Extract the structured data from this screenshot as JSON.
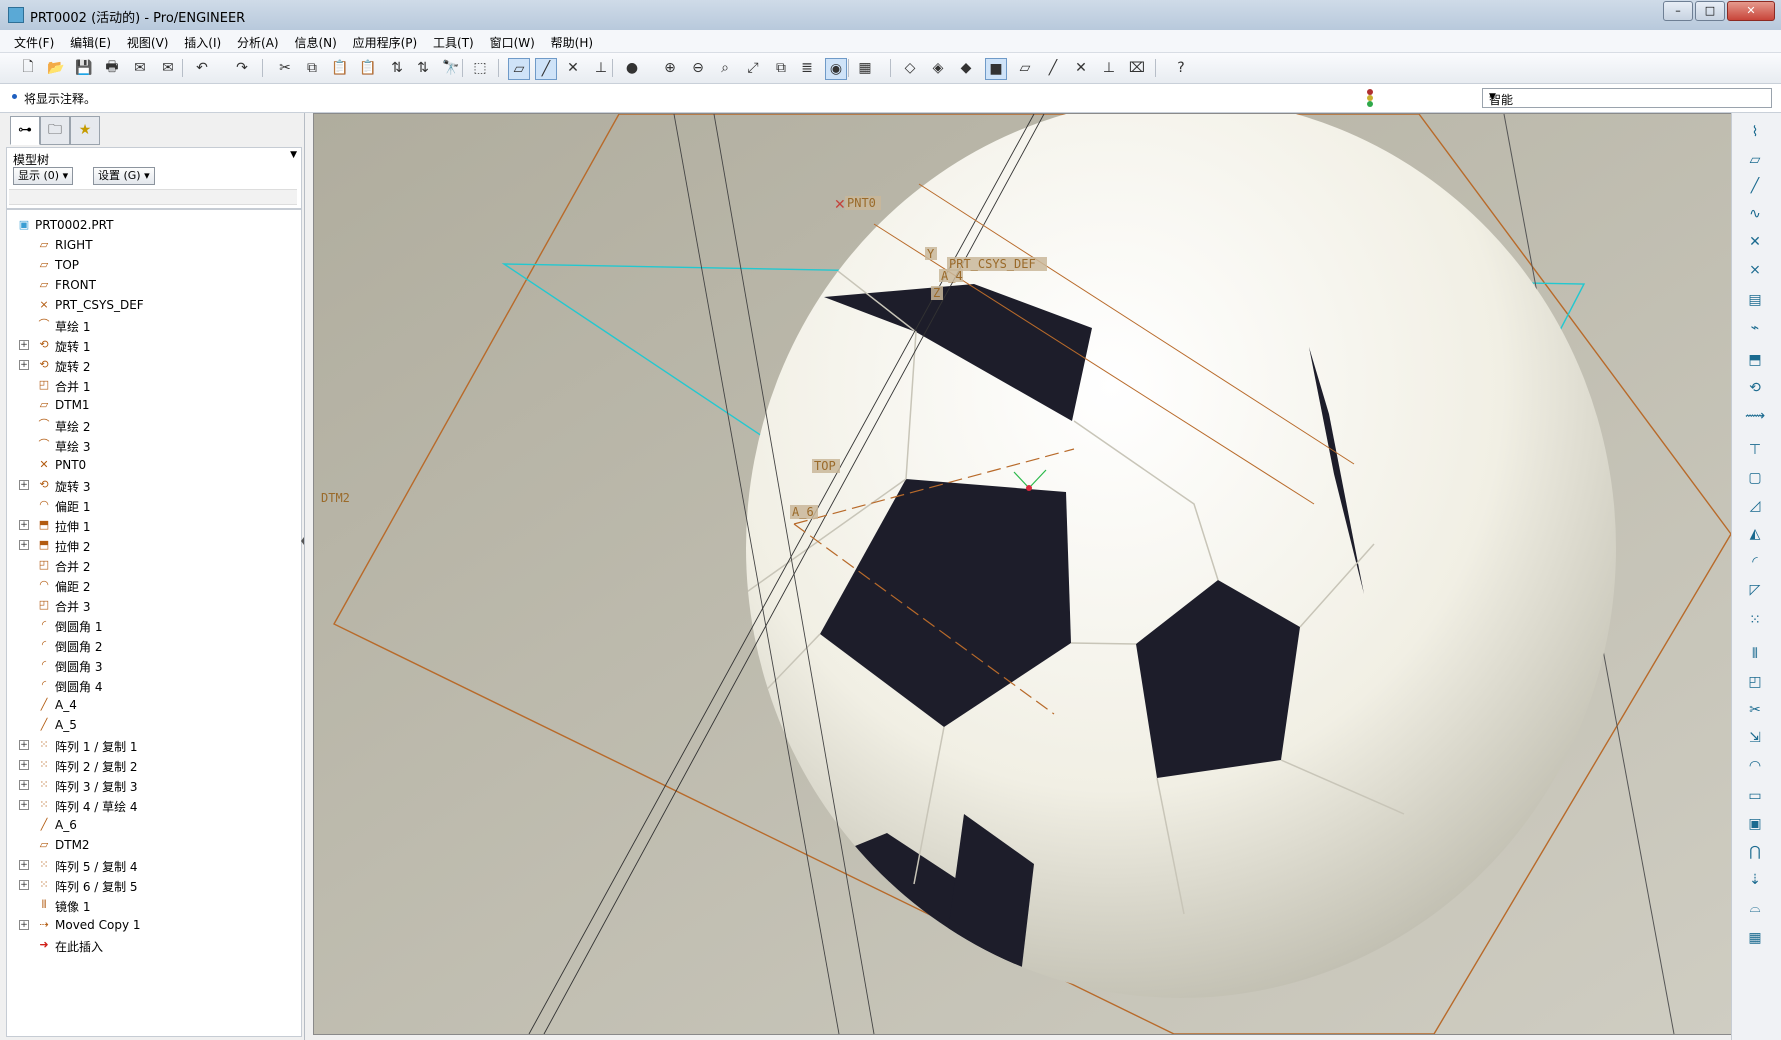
{
  "window": {
    "title": "PRT0002 (活动的) - Pro/ENGINEER",
    "controls": [
      "–",
      "□",
      "✕"
    ]
  },
  "menu": [
    "文件(F)",
    "编辑(E)",
    "视图(V)",
    "插入(I)",
    "分析(A)",
    "信息(N)",
    "应用程序(P)",
    "工具(T)",
    "窗口(W)",
    "帮助(H)"
  ],
  "toolbar": [
    {
      "icon": "new-icon",
      "glyph": "🗋"
    },
    {
      "icon": "open-icon",
      "glyph": "📂"
    },
    {
      "icon": "save-icon",
      "glyph": "💾"
    },
    {
      "icon": "print-icon",
      "glyph": "🖶"
    },
    {
      "icon": "send-mail-icon",
      "glyph": "✉"
    },
    {
      "icon": "send-mail-attach-icon",
      "glyph": "✉"
    },
    {
      "icon": "undo-icon",
      "glyph": "↶"
    },
    {
      "icon": "redo-icon",
      "glyph": "↷"
    },
    {
      "icon": "cut-icon",
      "glyph": "✂"
    },
    {
      "icon": "copy-icon",
      "glyph": "⧉"
    },
    {
      "icon": "paste-icon",
      "glyph": "📋"
    },
    {
      "icon": "paste-special-icon",
      "glyph": "📋"
    },
    {
      "icon": "regenerate-icon",
      "glyph": "⇅"
    },
    {
      "icon": "regenerate-manager-icon",
      "glyph": "⇅"
    },
    {
      "icon": "find-icon",
      "glyph": "🔭"
    },
    {
      "icon": "select-box-icon",
      "glyph": "⬚"
    },
    {
      "icon": "datum-plane-display-icon",
      "glyph": "▱"
    },
    {
      "icon": "datum-axis-display-icon",
      "glyph": "╱"
    },
    {
      "icon": "datum-point-display-icon",
      "glyph": "✕"
    },
    {
      "icon": "csys-display-icon",
      "glyph": "⊥"
    },
    {
      "icon": "shading-icon",
      "glyph": "●"
    },
    {
      "icon": "zoom-in-icon",
      "glyph": "⊕"
    },
    {
      "icon": "zoom-out-icon",
      "glyph": "⊖"
    },
    {
      "icon": "refit-icon",
      "glyph": "⌕"
    },
    {
      "icon": "reorient-icon",
      "glyph": "⤢"
    },
    {
      "icon": "saved-views-icon",
      "glyph": "⧉"
    },
    {
      "icon": "layers-icon",
      "glyph": "≣"
    },
    {
      "icon": "spin-center-icon",
      "glyph": "◉"
    },
    {
      "icon": "appearance-icon",
      "glyph": "▦"
    },
    {
      "icon": "wireframe-icon",
      "glyph": "◇"
    },
    {
      "icon": "hidden-line-icon",
      "glyph": "◈"
    },
    {
      "icon": "no-hidden-icon",
      "glyph": "◆"
    },
    {
      "icon": "shaded-icon",
      "glyph": "■"
    },
    {
      "icon": "plane-tag-icon",
      "glyph": "▱"
    },
    {
      "icon": "axis-tag-icon",
      "glyph": "╱"
    },
    {
      "icon": "point-tag-icon",
      "glyph": "✕"
    },
    {
      "icon": "csys-tag-icon",
      "glyph": "⊥"
    },
    {
      "icon": "annotation-icon",
      "glyph": "⌧"
    },
    {
      "icon": "context-help-icon",
      "glyph": "?"
    }
  ],
  "message": "将显示注释。",
  "filter": {
    "value": "智能"
  },
  "panel": {
    "tabs": [
      {
        "icon": "model-tree-tab-icon",
        "glyph": "⊶"
      },
      {
        "icon": "folder-browser-tab-icon",
        "glyph": "🗀"
      },
      {
        "icon": "favorites-tab-icon",
        "glyph": "★"
      }
    ],
    "header": "模型树",
    "show_btn": "显示 (0)",
    "settings_btn": "设置 (G)"
  },
  "tree": [
    {
      "label": "PRT0002.PRT",
      "icon": "part-icon",
      "glyph": "▣",
      "expand": false,
      "root": true
    },
    {
      "label": "RIGHT",
      "icon": "datum-plane-icon",
      "glyph": "▱",
      "expand": false
    },
    {
      "label": "TOP",
      "icon": "datum-plane-icon",
      "glyph": "▱",
      "expand": false
    },
    {
      "label": "FRONT",
      "icon": "datum-plane-icon",
      "glyph": "▱",
      "expand": false
    },
    {
      "label": "PRT_CSYS_DEF",
      "icon": "csys-icon",
      "glyph": "⨯",
      "expand": false
    },
    {
      "label": "草绘 1",
      "icon": "sketch-icon",
      "glyph": "⌒",
      "expand": false
    },
    {
      "label": "旋转 1",
      "icon": "revolve-icon",
      "glyph": "⟲",
      "expand": true
    },
    {
      "label": "旋转 2",
      "icon": "revolve-icon",
      "glyph": "⟲",
      "expand": true
    },
    {
      "label": "合并 1",
      "icon": "merge-icon",
      "glyph": "◰",
      "expand": false
    },
    {
      "label": "DTM1",
      "icon": "datum-plane-icon",
      "glyph": "▱",
      "expand": false
    },
    {
      "label": "草绘 2",
      "icon": "sketch-icon",
      "glyph": "⌒",
      "expand": false
    },
    {
      "label": "草绘 3",
      "icon": "sketch-icon",
      "glyph": "⌒",
      "expand": false
    },
    {
      "label": "PNT0",
      "icon": "datum-point-icon",
      "glyph": "✕",
      "expand": false
    },
    {
      "label": "旋转 3",
      "icon": "revolve-icon",
      "glyph": "⟲",
      "expand": true
    },
    {
      "label": "偏距 1",
      "icon": "offset-icon",
      "glyph": "◠",
      "expand": false
    },
    {
      "label": "拉伸 1",
      "icon": "extrude-icon",
      "glyph": "⬒",
      "expand": true
    },
    {
      "label": "拉伸 2",
      "icon": "extrude-icon",
      "glyph": "⬒",
      "expand": true
    },
    {
      "label": "合并 2",
      "icon": "merge-icon",
      "glyph": "◰",
      "expand": false
    },
    {
      "label": "偏距 2",
      "icon": "offset-icon",
      "glyph": "◠",
      "expand": false
    },
    {
      "label": "合并 3",
      "icon": "merge-icon",
      "glyph": "◰",
      "expand": false
    },
    {
      "label": "倒圆角 1",
      "icon": "round-icon",
      "glyph": "◜",
      "expand": false
    },
    {
      "label": "倒圆角 2",
      "icon": "round-icon",
      "glyph": "◜",
      "expand": false
    },
    {
      "label": "倒圆角 3",
      "icon": "round-icon",
      "glyph": "◜",
      "expand": false
    },
    {
      "label": "倒圆角 4",
      "icon": "round-icon",
      "glyph": "◜",
      "expand": false
    },
    {
      "label": "A_4",
      "icon": "datum-axis-icon",
      "glyph": "╱",
      "expand": false
    },
    {
      "label": "A_5",
      "icon": "datum-axis-icon",
      "glyph": "╱",
      "expand": false
    },
    {
      "label": "阵列 1 / 复制 1",
      "icon": "pattern-icon",
      "glyph": "⁙",
      "expand": true
    },
    {
      "label": "阵列 2 / 复制 2",
      "icon": "pattern-icon",
      "glyph": "⁙",
      "expand": true
    },
    {
      "label": "阵列 3 / 复制 3",
      "icon": "pattern-icon",
      "glyph": "⁙",
      "expand": true
    },
    {
      "label": "阵列 4 / 草绘 4",
      "icon": "pattern-icon",
      "glyph": "⁙",
      "expand": true
    },
    {
      "label": "A_6",
      "icon": "datum-axis-icon",
      "glyph": "╱",
      "expand": false
    },
    {
      "label": "DTM2",
      "icon": "datum-plane-icon",
      "glyph": "▱",
      "expand": false
    },
    {
      "label": "阵列 5 / 复制 4",
      "icon": "pattern-icon",
      "glyph": "⁙",
      "expand": true
    },
    {
      "label": "阵列 6 / 复制 5",
      "icon": "pattern-icon",
      "glyph": "⁙",
      "expand": true
    },
    {
      "label": "镜像 1",
      "icon": "mirror-icon",
      "glyph": "⫴",
      "expand": false
    },
    {
      "label": "Moved Copy 1",
      "icon": "moved-copy-icon",
      "glyph": "⇢",
      "expand": true
    },
    {
      "label": "在此插入",
      "icon": "insert-here-icon",
      "glyph": "➜",
      "expand": false
    }
  ],
  "viewport": {
    "background": "#a8a69a",
    "labels": {
      "pnt0": "PNT0",
      "csys": "PRT_CSYS_DEF",
      "csys_y": "Y",
      "csys_z": "Z",
      "a4": "A_4",
      "top": "TOP",
      "a6": "A_6",
      "dtm2": "DTM2"
    }
  },
  "rightbar": [
    {
      "icon": "sketch-tool-icon",
      "glyph": "⌇"
    },
    {
      "icon": "plane-tool-icon",
      "glyph": "▱"
    },
    {
      "icon": "axis-tool-icon",
      "glyph": "╱"
    },
    {
      "icon": "curve-tool-icon",
      "glyph": "∿"
    },
    {
      "icon": "point-tool-icon",
      "glyph": "✕"
    },
    {
      "icon": "csys-tool-icon",
      "glyph": "⨯"
    },
    {
      "icon": "analysis-feature-icon",
      "glyph": "▤"
    },
    {
      "icon": "graph-tool-icon",
      "glyph": "⌁"
    },
    {
      "icon": "extrude-tool-icon",
      "glyph": "⬒"
    },
    {
      "icon": "revolve-tool-icon",
      "glyph": "⟲"
    },
    {
      "icon": "variable-section-sweep-icon",
      "glyph": "⟿"
    },
    {
      "icon": "hole-tool-icon",
      "glyph": "⊤"
    },
    {
      "icon": "shell-tool-icon",
      "glyph": "▢"
    },
    {
      "icon": "rib-tool-icon",
      "glyph": "◿"
    },
    {
      "icon": "draft-tool-icon",
      "glyph": "◭"
    },
    {
      "icon": "round-tool-icon",
      "glyph": "◜"
    },
    {
      "icon": "chamfer-tool-icon",
      "glyph": "◸"
    },
    {
      "icon": "pattern-tool-icon",
      "glyph": "⁙"
    },
    {
      "icon": "mirror-tool-icon",
      "glyph": "⫴"
    },
    {
      "icon": "merge-tool-icon",
      "glyph": "◰"
    },
    {
      "icon": "trim-tool-icon",
      "glyph": "✂"
    },
    {
      "icon": "extend-tool-icon",
      "glyph": "⇲"
    },
    {
      "icon": "offset-tool-icon",
      "glyph": "◠"
    },
    {
      "icon": "thicken-tool-icon",
      "glyph": "▭"
    },
    {
      "icon": "solidify-tool-icon",
      "glyph": "▣"
    },
    {
      "icon": "intersect-tool-icon",
      "glyph": "⋂"
    },
    {
      "icon": "project-tool-icon",
      "glyph": "⇣"
    },
    {
      "icon": "wrap-tool-icon",
      "glyph": "⌓"
    },
    {
      "icon": "table-tool-icon",
      "glyph": "▦"
    }
  ]
}
